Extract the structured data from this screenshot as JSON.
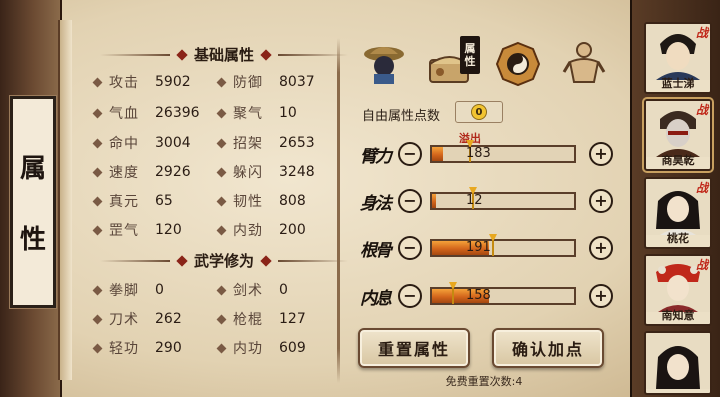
{
  "panel_title": [
    "属",
    "性"
  ],
  "basic_attributes": {
    "header": "基础属性",
    "stats": [
      {
        "name": "攻击",
        "value": "5902"
      },
      {
        "name": "防御",
        "value": "8037"
      },
      {
        "name": "气血",
        "value": "26396"
      },
      {
        "name": "聚气",
        "value": "10"
      },
      {
        "name": "命中",
        "value": "3004"
      },
      {
        "name": "招架",
        "value": "2653"
      },
      {
        "name": "速度",
        "value": "2926"
      },
      {
        "name": "躲闪",
        "value": "3248"
      },
      {
        "name": "真元",
        "value": "65"
      },
      {
        "name": "韧性",
        "value": "808"
      },
      {
        "name": "罡气",
        "value": "120"
      },
      {
        "name": "内劲",
        "value": "200"
      }
    ]
  },
  "martial_arts": {
    "header": "武学修为",
    "stats": [
      {
        "name": "拳脚",
        "value": "0"
      },
      {
        "name": "剑术",
        "value": "0"
      },
      {
        "name": "刀术",
        "value": "262"
      },
      {
        "name": "枪棍",
        "value": "127"
      },
      {
        "name": "轻功",
        "value": "290"
      },
      {
        "name": "内功",
        "value": "609"
      }
    ]
  },
  "tabs": [
    {
      "icon": "hat-figure-icon"
    },
    {
      "icon": "scroll-chest-icon",
      "badge": "属性"
    },
    {
      "icon": "bagua-icon"
    },
    {
      "icon": "muscle-figure-icon"
    }
  ],
  "tab_badge_chars": [
    "属",
    "性"
  ],
  "free_points": {
    "label": "自由属性点数",
    "value": "0"
  },
  "overflow_label": "溢出",
  "attributes": [
    {
      "label": "臂力",
      "value": "183",
      "fill": 0.08,
      "marker": 0.24
    },
    {
      "label": "身法",
      "value": "12",
      "fill": 0.03,
      "marker": 0.26
    },
    {
      "label": "根骨",
      "value": "191",
      "fill": 0.4,
      "marker": 0.4
    },
    {
      "label": "内息",
      "value": "158",
      "fill": 0.4,
      "marker": 0.12
    }
  ],
  "minus_symbol": "−",
  "plus_symbol": "+",
  "buttons": {
    "reset": "重置属性",
    "confirm": "确认加点"
  },
  "free_reset": "免费重置次数:4",
  "characters": [
    {
      "name": "蓝士涕",
      "badge": "战"
    },
    {
      "name": "商昊乾",
      "badge": "战"
    },
    {
      "name": "桃花",
      "badge": "战"
    },
    {
      "name": "南知意",
      "badge": "战"
    },
    {
      "name": "",
      "badge": ""
    }
  ],
  "colors": {
    "accent": "#d4661c",
    "overflow": "#b0281a",
    "parchment": "#e2d2b2"
  }
}
